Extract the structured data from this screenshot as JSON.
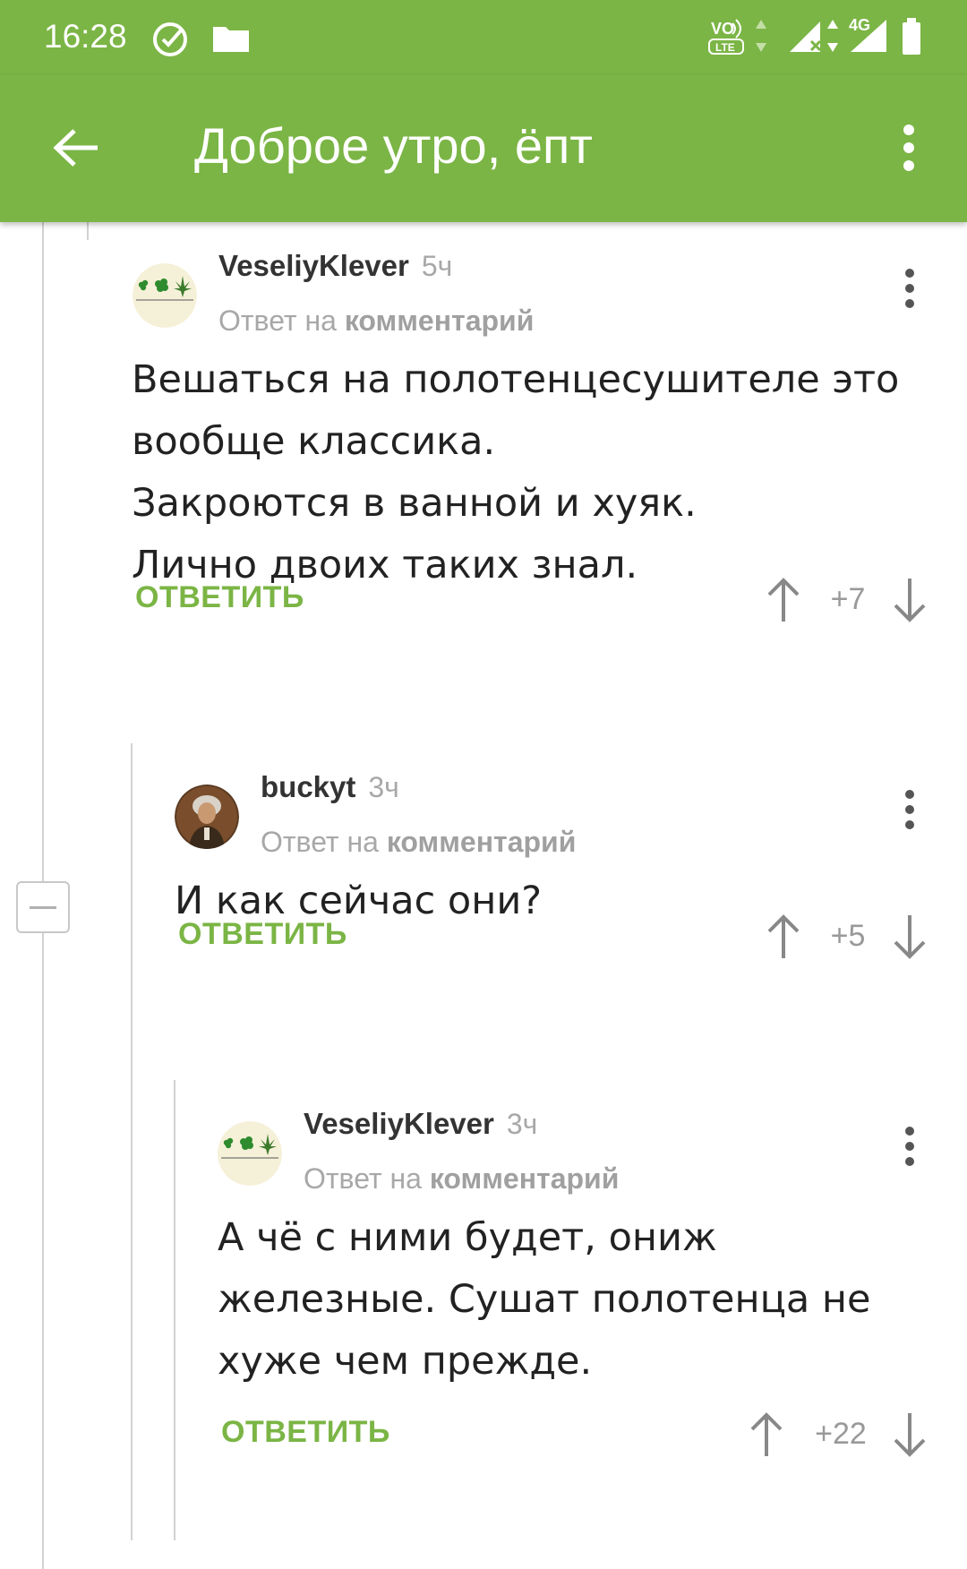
{
  "status_bar": {
    "time": "16:28",
    "icons": [
      "check-circle-icon",
      "folder-icon",
      "volte-icon",
      "data-arrows-icon",
      "signal-icon",
      "signal-4g-icon",
      "battery-icon"
    ],
    "network_label": "4G",
    "volte_label": "VoLTE"
  },
  "app_bar": {
    "title": "Доброе утро, ёпт",
    "back_icon": "arrow-back-icon",
    "menu_icon": "more-vert-icon"
  },
  "comments": [
    {
      "author": "VeseliyKlever",
      "time": "5ч",
      "reply_prefix": "Ответ на",
      "reply_target": "комментарий",
      "body": "Вешаться на полотенцесушителе это\nвообще классика.\nЗакроются в ванной и хуяк.\nЛично двоих таких знал.",
      "reply_label": "ОТВЕТИТЬ",
      "score": "+7"
    },
    {
      "author": "buckyt",
      "time": "3ч",
      "reply_prefix": "Ответ на",
      "reply_target": "комментарий",
      "body": "И как сейчас они?",
      "reply_label": "ОТВЕТИТЬ",
      "score": "+5"
    },
    {
      "author": "VeseliyKlever",
      "time": "3ч",
      "reply_prefix": "Ответ на",
      "reply_target": "комментарий",
      "body": "А чё с ними будет, ониж\nжелезные. Сушат полотенца не\nхуже чем прежде.",
      "reply_label": "ОТВЕТИТЬ",
      "score": "+22"
    }
  ],
  "colors": {
    "accent": "#7bb545",
    "text": "#222222",
    "muted": "#a8a8a8"
  }
}
